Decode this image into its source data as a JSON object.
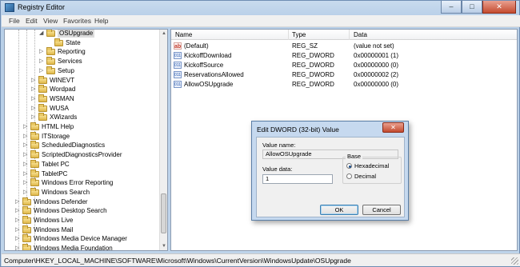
{
  "window": {
    "title": "Registry Editor",
    "controls": {
      "minimize": "–",
      "maximize": "□",
      "close": "✕"
    }
  },
  "menu": [
    "File",
    "Edit",
    "View",
    "Favorites",
    "Help"
  ],
  "tree": [
    {
      "label": "OSUpgrade",
      "level": 4,
      "expanded": true,
      "selected": true
    },
    {
      "label": "State",
      "level": 5,
      "expanded": null
    },
    {
      "label": "Reporting",
      "level": 4,
      "expanded": false
    },
    {
      "label": "Services",
      "level": 4,
      "expanded": false
    },
    {
      "label": "Setup",
      "level": 4,
      "expanded": false
    },
    {
      "label": "WINEVT",
      "level": 3,
      "expanded": false
    },
    {
      "label": "Wordpad",
      "level": 3,
      "expanded": false
    },
    {
      "label": "WSMAN",
      "level": 3,
      "expanded": false
    },
    {
      "label": "WUSA",
      "level": 3,
      "expanded": false
    },
    {
      "label": "XWizards",
      "level": 3,
      "expanded": false
    },
    {
      "label": "HTML Help",
      "level": 2,
      "expanded": false
    },
    {
      "label": "ITStorage",
      "level": 2,
      "expanded": false
    },
    {
      "label": "ScheduledDiagnostics",
      "level": 2,
      "expanded": false
    },
    {
      "label": "ScriptedDiagnosticsProvider",
      "level": 2,
      "expanded": false
    },
    {
      "label": "Tablet PC",
      "level": 2,
      "expanded": false
    },
    {
      "label": "TabletPC",
      "level": 2,
      "expanded": false
    },
    {
      "label": "Windows Error Reporting",
      "level": 2,
      "expanded": false
    },
    {
      "label": "Windows Search",
      "level": 2,
      "expanded": false
    },
    {
      "label": "Windows Defender",
      "level": 1,
      "expanded": false
    },
    {
      "label": "Windows Desktop Search",
      "level": 1,
      "expanded": false
    },
    {
      "label": "Windows Live",
      "level": 1,
      "expanded": false
    },
    {
      "label": "Windows Mail",
      "level": 1,
      "expanded": false
    },
    {
      "label": "Windows Media Device Manager",
      "level": 1,
      "expanded": false
    },
    {
      "label": "Windows Media Foundation",
      "level": 1,
      "expanded": false
    }
  ],
  "list": {
    "columns": [
      "Name",
      "Type",
      "Data"
    ],
    "rows": [
      {
        "icon": "ab",
        "name": "(Default)",
        "type": "REG_SZ",
        "data": "(value not set)"
      },
      {
        "icon": "bin",
        "name": "KickoffDownload",
        "type": "REG_DWORD",
        "data": "0x00000001 (1)"
      },
      {
        "icon": "bin",
        "name": "KickoffSource",
        "type": "REG_DWORD",
        "data": "0x00000000 (0)"
      },
      {
        "icon": "bin",
        "name": "ReservationsAllowed",
        "type": "REG_DWORD",
        "data": "0x00000002 (2)"
      },
      {
        "icon": "bin",
        "name": "AllowOSUpgrade",
        "type": "REG_DWORD",
        "data": "0x00000000 (0)"
      }
    ]
  },
  "status": "Computer\\HKEY_LOCAL_MACHINE\\SOFTWARE\\Microsoft\\Windows\\CurrentVersion\\WindowsUpdate\\OSUpgrade",
  "dialog": {
    "title": "Edit DWORD (32-bit) Value",
    "close": "✕",
    "value_name_label": "Value name:",
    "value_name": "AllowOSUpgrade",
    "value_data_label": "Value data:",
    "value_data": "1",
    "base_label": "Base",
    "hex_label": "Hexadecimal",
    "dec_label": "Decimal",
    "selected_base": "Hexadecimal",
    "ok": "OK",
    "cancel": "Cancel"
  }
}
